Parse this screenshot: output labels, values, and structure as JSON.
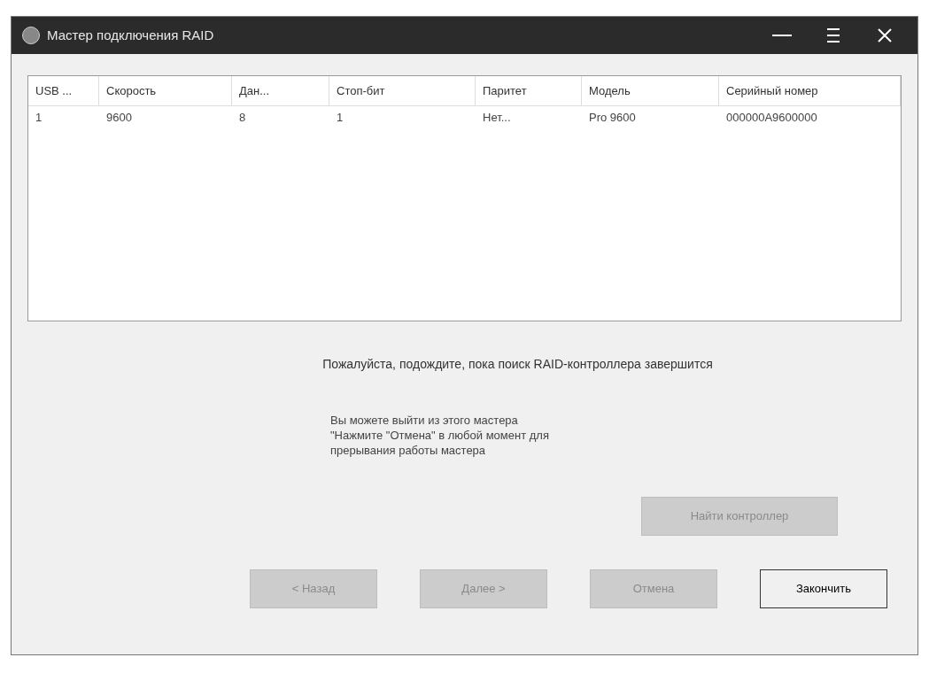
{
  "window": {
    "title": "Мастер подключения RAID"
  },
  "table": {
    "columns": [
      "USB ...",
      "Скорость",
      "Дан...",
      "Стоп-бит",
      "Паритет",
      "Модель",
      "Серийный номер"
    ],
    "rows": [
      [
        "1",
        "9600",
        "8",
        "1",
        "Нет...",
        "Pro 9600",
        "000000A9600000"
      ]
    ]
  },
  "status_text": "Пожалуйста, подождите, пока поиск RAID-контроллера завершится",
  "info_lines": [
    "Вы можете выйти из этого мастера",
    "\"Нажмите \"Отмена\" в любой момент для",
    "прерывания работы мастера"
  ],
  "search_button": {
    "label": "Найти контроллер",
    "disabled": true
  },
  "buttons": [
    {
      "label": "< Назад",
      "disabled": true
    },
    {
      "label": "Далее >",
      "disabled": true
    },
    {
      "label": "Отмена",
      "disabled": true
    },
    {
      "label": "Закончить",
      "disabled": false
    }
  ]
}
